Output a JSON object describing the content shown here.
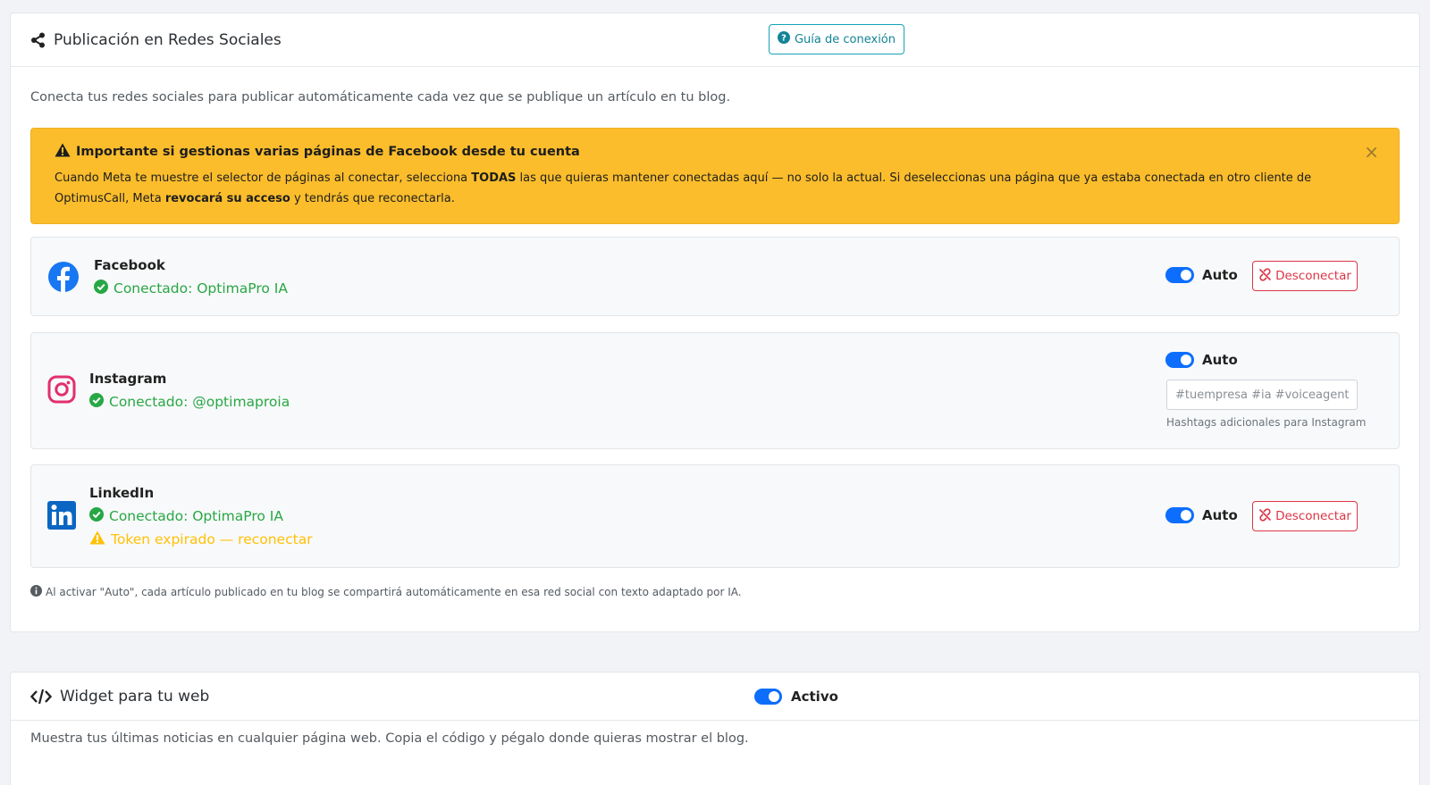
{
  "social": {
    "title": "Publicación en Redes Sociales",
    "guide_button": "Guía de conexión",
    "intro": "Conecta tus redes sociales para publicar automáticamente cada vez que se publique un artículo en tu blog.",
    "alert": {
      "title": "Importante si gestionas varias páginas de Facebook desde tu cuenta",
      "body_1": "Cuando Meta te muestre el selector de páginas al conectar, selecciona ",
      "body_bold_1": "TODAS",
      "body_2": " las que quieras mantener conectadas aquí — no solo la actual. Si deseleccionas una página que ya estaba conectada en otro cliente de OptimusCall, Meta ",
      "body_bold_2": "revocará su acceso",
      "body_3": " y tendrás que reconectarla.",
      "close": "×"
    },
    "networks": {
      "facebook": {
        "name": "Facebook",
        "status": "Conectado: OptimaPro IA",
        "toggle_label": "Auto",
        "toggle_on": true,
        "disconnect": "Desconectar",
        "icon": "facebook-icon",
        "color": "#1877f2"
      },
      "instagram": {
        "name": "Instagram",
        "status": "Conectado: @optimaproia",
        "toggle_label": "Auto",
        "toggle_on": true,
        "hashtags_placeholder": "#tuempresa #ia #voiceagent",
        "hashtags_help": "Hashtags adicionales para Instagram",
        "icon": "instagram-icon",
        "color": "#e1306c"
      },
      "linkedin": {
        "name": "LinkedIn",
        "status": "Conectado: OptimaPro IA",
        "warning": "Token expirado — reconectar",
        "toggle_label": "Auto",
        "toggle_on": true,
        "disconnect": "Desconectar",
        "icon": "linkedin-icon",
        "color": "#0a66c2"
      }
    },
    "footnote": "Al activar \"Auto\", cada artículo publicado en tu blog se compartirá automáticamente en esa red social con texto adaptado por IA."
  },
  "widget": {
    "title": "Widget para tu web",
    "toggle_label": "Activo",
    "toggle_on": true,
    "intro": "Muestra tus últimas noticias en cualquier página web. Copia el código y pégalo donde quieras mostrar el blog."
  },
  "colors": {
    "success": "#28a745",
    "warning": "#ffc107",
    "danger": "#dc3545",
    "info": "#17a2b8",
    "toggle": "#0d6efd",
    "alert_bg": "#fbbd2c"
  }
}
